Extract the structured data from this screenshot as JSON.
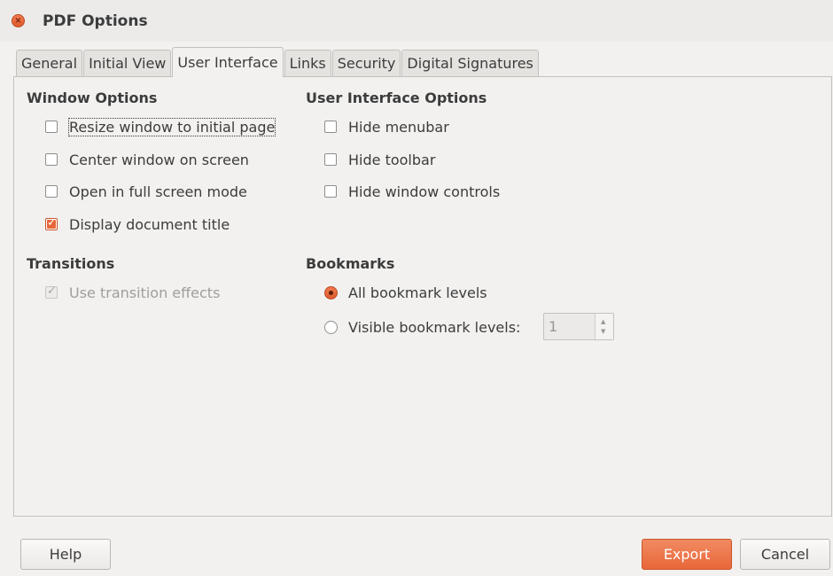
{
  "window": {
    "title": "PDF Options",
    "close_glyph": "×"
  },
  "tabs": [
    {
      "label": "General",
      "active": false
    },
    {
      "label": "Initial View",
      "active": false
    },
    {
      "label": "User Interface",
      "active": true
    },
    {
      "label": "Links",
      "active": false
    },
    {
      "label": "Security",
      "active": false
    },
    {
      "label": "Digital Signatures",
      "active": false
    }
  ],
  "window_options": {
    "title": "Window Options",
    "items": [
      {
        "label": "Resize window to initial page",
        "checked": false
      },
      {
        "label": "Center window on screen",
        "checked": false
      },
      {
        "label": "Open in full screen mode",
        "checked": false
      },
      {
        "label": "Display document title",
        "checked": true
      }
    ]
  },
  "ui_options": {
    "title": "User Interface Options",
    "items": [
      {
        "label": "Hide menubar",
        "checked": false
      },
      {
        "label": "Hide toolbar",
        "checked": false
      },
      {
        "label": "Hide window controls",
        "checked": false
      }
    ]
  },
  "transitions": {
    "title": "Transitions",
    "use_effects": {
      "label": "Use transition effects",
      "checked": true,
      "enabled": false
    }
  },
  "bookmarks": {
    "title": "Bookmarks",
    "all_levels": {
      "label": "All bookmark levels",
      "selected": true
    },
    "visible_levels": {
      "label": "Visible bookmark levels:",
      "selected": false
    },
    "levels_value": "1"
  },
  "buttons": {
    "help": "Help",
    "export": "Export",
    "cancel": "Cancel"
  },
  "colors": {
    "accent": "#e8673a",
    "background": "#f2f1f0"
  }
}
